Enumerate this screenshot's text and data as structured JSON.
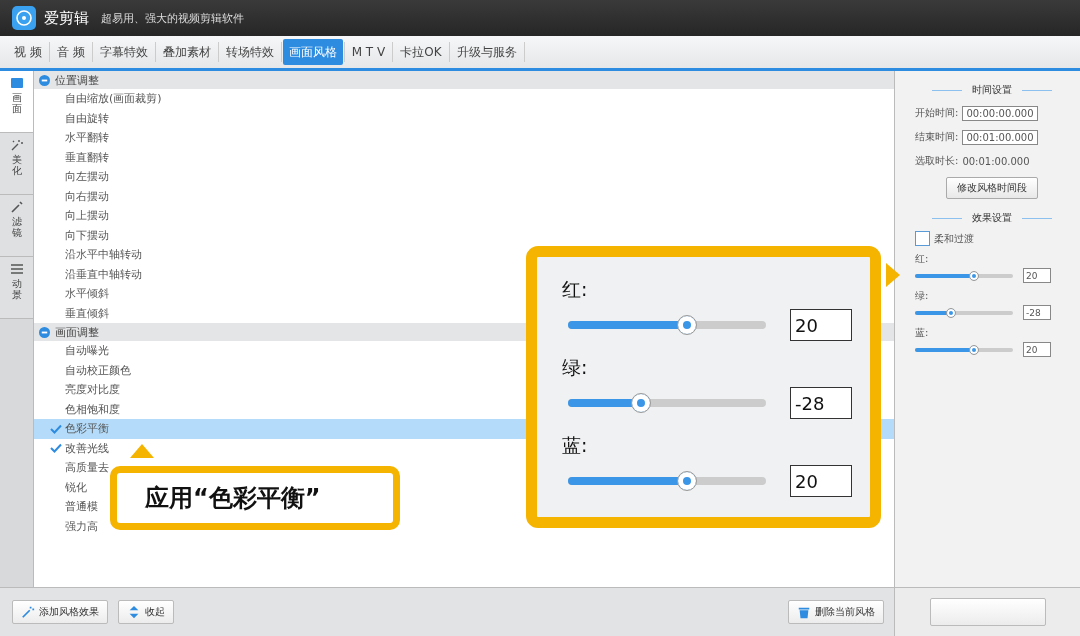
{
  "window": {
    "app_name": "爱剪辑",
    "subtitle": "超易用、强大的视频剪辑软件"
  },
  "tabs": [
    {
      "label": "视  频",
      "selected": false
    },
    {
      "label": "音  频",
      "selected": false
    },
    {
      "label": "字幕特效",
      "selected": false
    },
    {
      "label": "叠加素材",
      "selected": false
    },
    {
      "label": "转场特效",
      "selected": false
    },
    {
      "label": "画面风格",
      "selected": true
    },
    {
      "label": "M T V",
      "selected": false
    },
    {
      "label": "卡拉OK",
      "selected": false
    },
    {
      "label": "升级与服务",
      "selected": false
    }
  ],
  "side_tabs": [
    {
      "label": "画面",
      "kind": "screen",
      "selected": true
    },
    {
      "label": "美化",
      "kind": "wand",
      "selected": false
    },
    {
      "label": "滤镜",
      "kind": "brush",
      "selected": false
    },
    {
      "label": "动景",
      "kind": "lines",
      "selected": false
    }
  ],
  "tree": [
    {
      "label": "位置调整",
      "expanded": true,
      "children": [
        {
          "label": "自由缩放(画面裁剪)",
          "checked": false,
          "selected": false
        },
        {
          "label": "自由旋转",
          "checked": false,
          "selected": false
        },
        {
          "label": "水平翻转",
          "checked": false,
          "selected": false
        },
        {
          "label": "垂直翻转",
          "checked": false,
          "selected": false
        },
        {
          "label": "向左摆动",
          "checked": false,
          "selected": false
        },
        {
          "label": "向右摆动",
          "checked": false,
          "selected": false
        },
        {
          "label": "向上摆动",
          "checked": false,
          "selected": false
        },
        {
          "label": "向下摆动",
          "checked": false,
          "selected": false
        },
        {
          "label": "沿水平中轴转动",
          "checked": false,
          "selected": false
        },
        {
          "label": "沿垂直中轴转动",
          "checked": false,
          "selected": false
        },
        {
          "label": "水平倾斜",
          "checked": false,
          "selected": false
        },
        {
          "label": "垂直倾斜",
          "checked": false,
          "selected": false
        }
      ]
    },
    {
      "label": "画面调整",
      "expanded": true,
      "children": [
        {
          "label": "自动曝光",
          "checked": false,
          "selected": false
        },
        {
          "label": "自动校正颜色",
          "checked": false,
          "selected": false
        },
        {
          "label": "亮度对比度",
          "checked": false,
          "selected": false
        },
        {
          "label": "色相饱和度",
          "checked": false,
          "selected": false
        },
        {
          "label": "色彩平衡",
          "checked": true,
          "selected": true
        },
        {
          "label": "改善光线",
          "checked": true,
          "selected": false
        },
        {
          "label": "高质量去",
          "checked": false,
          "selected": false
        },
        {
          "label": "锐化",
          "checked": false,
          "selected": false
        },
        {
          "label": "普通模",
          "checked": false,
          "selected": false
        },
        {
          "label": "强力高",
          "checked": false,
          "selected": false
        }
      ]
    }
  ],
  "callout_apply": {
    "text": "应用“色彩平衡”"
  },
  "callout_sliders": [
    {
      "label": "红:",
      "level": 0.6,
      "value": "20"
    },
    {
      "label": "绿:",
      "level": 0.37,
      "value": "-28"
    },
    {
      "label": "蓝:",
      "level": 0.6,
      "value": "20"
    }
  ],
  "right_panel": {
    "time_heading": "时间设置",
    "start_label": "开始时间:",
    "start_value": "00:00:00.000",
    "end_label": "结束时间:",
    "end_value": "00:01:00.000",
    "duration_label": "选取时长:",
    "duration_value": "00:01:00.000",
    "modify_button": "修改风格时间段",
    "effect_heading": "效果设置",
    "smooth": {
      "label": "柔和过渡",
      "checked": false
    },
    "sliders": [
      {
        "label": "红:",
        "level": 0.6,
        "value": "20"
      },
      {
        "label": "绿:",
        "level": 0.37,
        "value": "-28"
      },
      {
        "label": "蓝:",
        "level": 0.6,
        "value": "20"
      }
    ]
  },
  "bottom": {
    "add_button": "添加风格效果",
    "collapse_button": "收起",
    "delete_button": "删除当前风格"
  }
}
